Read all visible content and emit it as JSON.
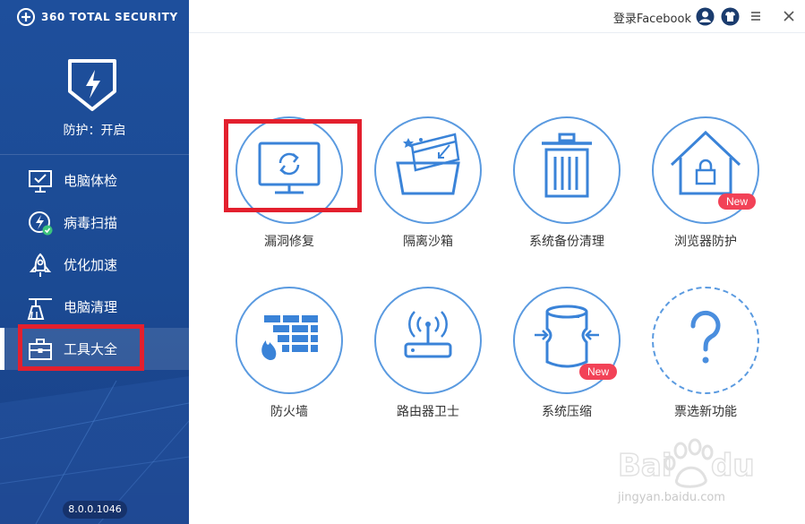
{
  "app": {
    "brand": "360 TOTAL SECURITY",
    "protection_status": "防护：开启",
    "version": "8.0.0.1046"
  },
  "sidebar": {
    "items": [
      {
        "label": "电脑体检",
        "icon": "monitor-check-icon"
      },
      {
        "label": "病毒扫描",
        "icon": "virus-scan-icon"
      },
      {
        "label": "优化加速",
        "icon": "rocket-icon"
      },
      {
        "label": "电脑清理",
        "icon": "broom-icon"
      },
      {
        "label": "工具大全",
        "icon": "toolbox-icon",
        "active": true
      }
    ]
  },
  "topbar": {
    "login_label": "登录Facebook",
    "icons": [
      "user-icon",
      "skin-icon",
      "menu-icon",
      "close-icon"
    ]
  },
  "tools": [
    {
      "label": "漏洞修复",
      "icon": "monitor-refresh-icon"
    },
    {
      "label": "隔离沙箱",
      "icon": "sandbox-icon"
    },
    {
      "label": "系统备份清理",
      "icon": "trash-bin-icon"
    },
    {
      "label": "浏览器防护",
      "icon": "house-lock-icon",
      "badge": "New"
    },
    {
      "label": "防火墙",
      "icon": "firewall-icon"
    },
    {
      "label": "路由器卫士",
      "icon": "router-icon"
    },
    {
      "label": "系统压缩",
      "icon": "compress-icon",
      "badge": "New"
    },
    {
      "label": "票选新功能",
      "icon": "question-icon"
    }
  ],
  "watermark": {
    "text": "jingyan.baidu.com"
  },
  "colors": {
    "sidebar_bg": "#1e4f9c",
    "accent_blue": "#5a9ae0",
    "highlight_red": "#e3202e",
    "badge_red": "#f24257"
  }
}
